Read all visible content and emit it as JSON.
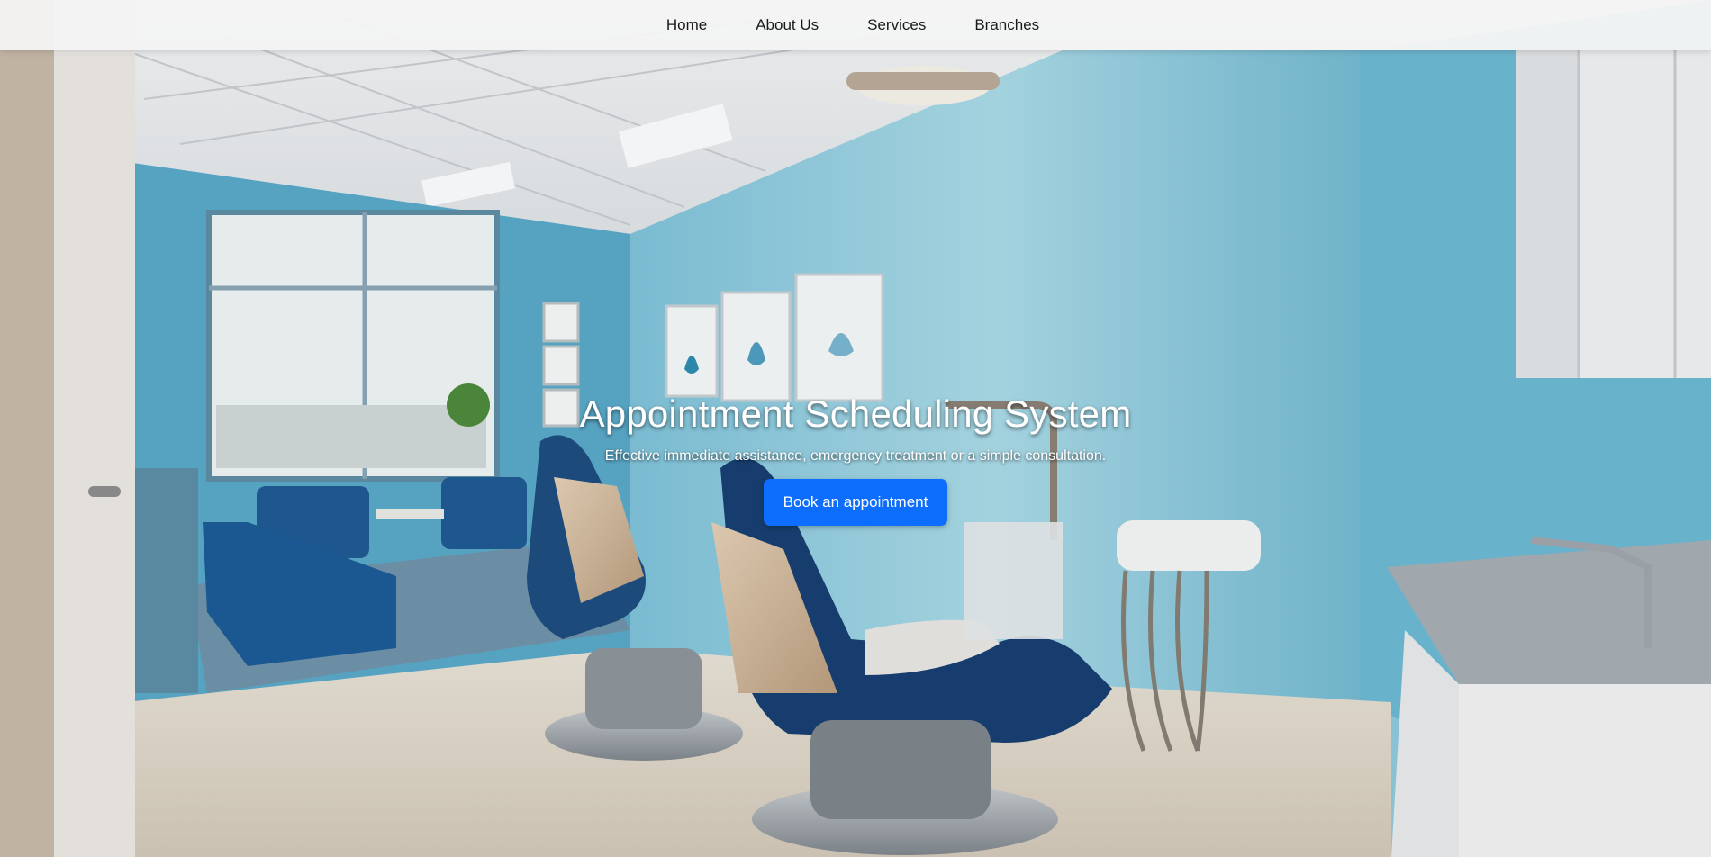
{
  "nav": {
    "items": [
      {
        "label": "Home"
      },
      {
        "label": "About Us"
      },
      {
        "label": "Services"
      },
      {
        "label": "Branches"
      }
    ]
  },
  "hero": {
    "title": "Appointment Scheduling System",
    "subtitle": "Effective immediate assistance, emergency treatment or a simple consultation.",
    "cta_label": "Book an appointment"
  },
  "colors": {
    "accent": "#0d6efd",
    "wall": "#8fc9dc",
    "nav_bg": "#f4f4f4"
  }
}
